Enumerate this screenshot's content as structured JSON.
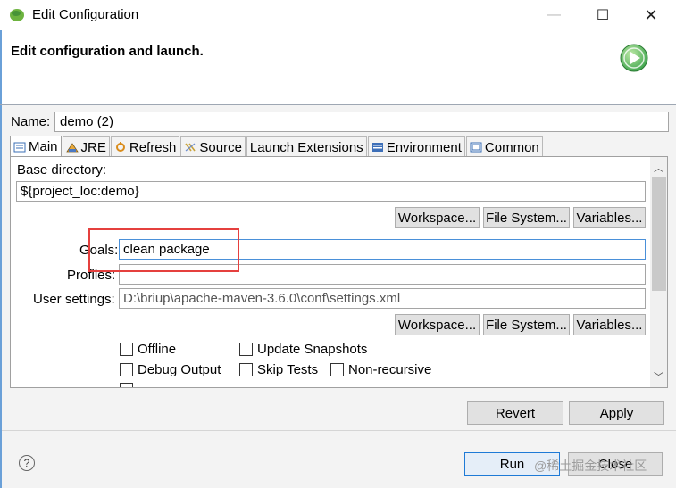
{
  "window": {
    "title": "Edit Configuration",
    "minimize_glyph": "—",
    "maximize_glyph": "☐",
    "close_glyph": "✕"
  },
  "header": {
    "title": "Edit configuration and launch."
  },
  "config": {
    "name_label": "Name:",
    "name_value": "demo (2)"
  },
  "tabs": [
    {
      "label": "Main",
      "icon": "main-tab-icon",
      "active": true
    },
    {
      "label": "JRE",
      "icon": "jre-tab-icon",
      "active": false
    },
    {
      "label": "Refresh",
      "icon": "refresh-tab-icon",
      "active": false
    },
    {
      "label": "Source",
      "icon": "source-tab-icon",
      "active": false
    },
    {
      "label": "Launch Extensions",
      "icon": "",
      "active": false
    },
    {
      "label": "Environment",
      "icon": "environment-tab-icon",
      "active": false
    },
    {
      "label": "Common",
      "icon": "common-tab-icon",
      "active": false
    }
  ],
  "main": {
    "base_dir_label": "Base directory:",
    "base_dir_value": "${project_loc:demo}",
    "buttons": {
      "workspace": "Workspace...",
      "file_system": "File System...",
      "variables": "Variables..."
    },
    "goals_label": "Goals:",
    "goals_value": "clean package",
    "profiles_label": "Profiles:",
    "profiles_value": "",
    "user_settings_label": "User settings:",
    "user_settings_value": "D:\\briup\\apache-maven-3.6.0\\conf\\settings.xml",
    "options": {
      "offline": "Offline",
      "update_snapshots": "Update Snapshots",
      "debug_output": "Debug Output",
      "skip_tests": "Skip Tests",
      "non_recursive": "Non-recursive"
    }
  },
  "footer": {
    "revert": "Revert",
    "apply": "Apply",
    "run": "Run",
    "close": "Close",
    "help_glyph": "?"
  },
  "watermark": "@稀土掘金技术社区",
  "colors": {
    "accent_blue": "#1e7ad6",
    "highlight_red": "#e5403e",
    "run_green": "#3aa34a"
  }
}
